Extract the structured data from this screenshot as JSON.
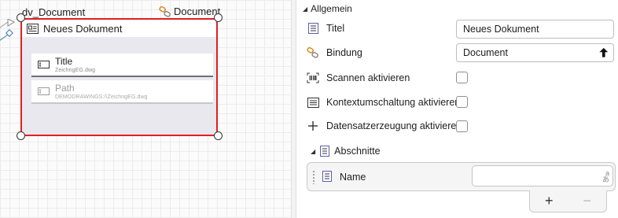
{
  "canvas": {
    "datasource_name": "dv_Document",
    "datasource_binding": "Document",
    "frame_title": "Neues Dokument",
    "fields": [
      {
        "label": "Title",
        "value": "ZeichngEG.dwg"
      },
      {
        "label": "Path",
        "value": "DEMODRAWINGS:/\\ZeichngEG.dwg"
      }
    ]
  },
  "panel": {
    "section_title": "Allgemein",
    "title_label": "Titel",
    "title_value": "Neues Dokument",
    "binding_label": "Bindung",
    "binding_value": "Document",
    "scan_label": "Scannen aktivieren",
    "context_label": "Kontextumschaltung aktivieren",
    "record_label": "Datensatzerzeugung aktivieren",
    "sections_label": "Abschnitte",
    "list_item_label": "Name",
    "list_item_value": "",
    "add_symbol": "+",
    "remove_symbol": "−",
    "lang_glyph_top": "a",
    "lang_glyph_bottom": "あ"
  },
  "colors": {
    "selection_border": "#e02020",
    "frame_background": "#e9e8ee",
    "icon_blue": "#5b5bb0",
    "binding_orange": "#d98a1e"
  },
  "icons": {
    "frame": "document-card-icon",
    "field": "text-field-icon",
    "binding": "link-chain-icon",
    "scan": "barcode-scan-icon",
    "context": "list-lines-icon",
    "record": "plus-icon",
    "section": "section-list-icon"
  }
}
